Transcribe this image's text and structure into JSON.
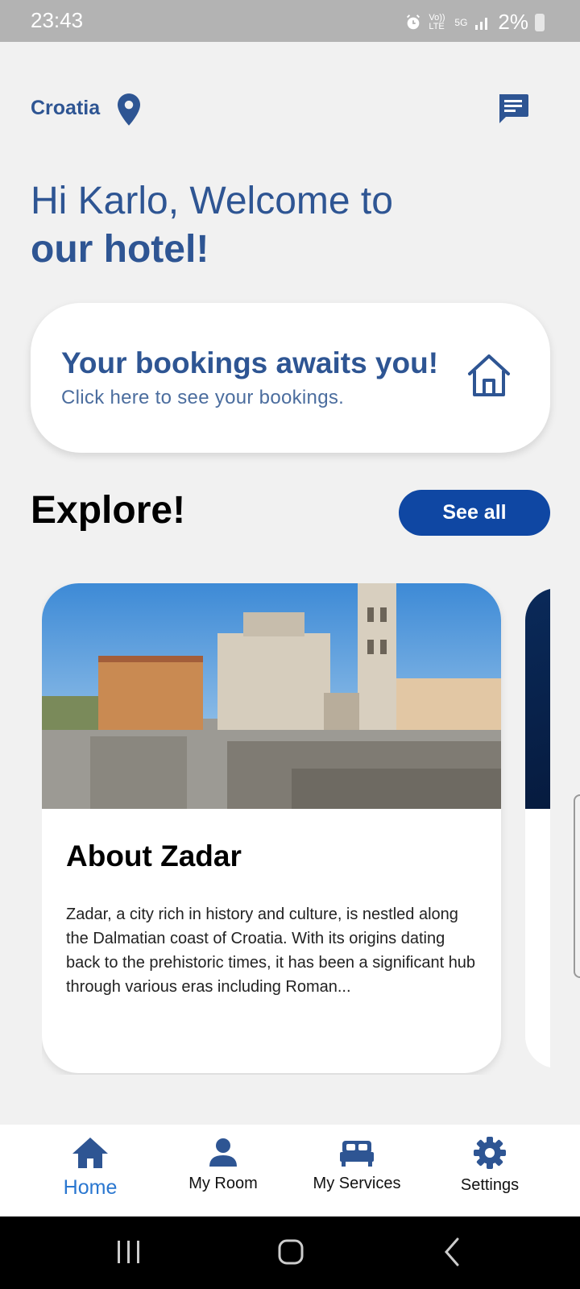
{
  "status_bar": {
    "time": "23:43",
    "network_lte": "Vo)) LTE",
    "network_5g": "5G",
    "battery": "2%"
  },
  "header": {
    "location": "Croatia"
  },
  "welcome": {
    "line1": "Hi Karlo, Welcome to",
    "line2": "our hotel!"
  },
  "booking_card": {
    "title": "Your bookings awaits you!",
    "subtitle": "Click here to see your bookings."
  },
  "explore": {
    "title": "Explore!",
    "see_all_label": "See all",
    "cards": [
      {
        "title": "About Zadar",
        "text": "Zadar, a city rich in history and culture, is nestled along the Dalmatian coast of Croatia. With its origins dating back to the prehistoric times, it has been a significant hub through various eras including Roman..."
      }
    ]
  },
  "bottom_nav": {
    "items": [
      {
        "label": "Home",
        "icon": "home-icon",
        "active": true
      },
      {
        "label": "My Room",
        "icon": "person-icon",
        "active": false
      },
      {
        "label": "My Services",
        "icon": "bed-icon",
        "active": false
      },
      {
        "label": "Settings",
        "icon": "gear-icon",
        "active": false
      }
    ]
  },
  "colors": {
    "primary": "#2e5593",
    "button": "#0f47a3",
    "active_nav": "#2a77d0",
    "background": "#f1f1f1"
  }
}
